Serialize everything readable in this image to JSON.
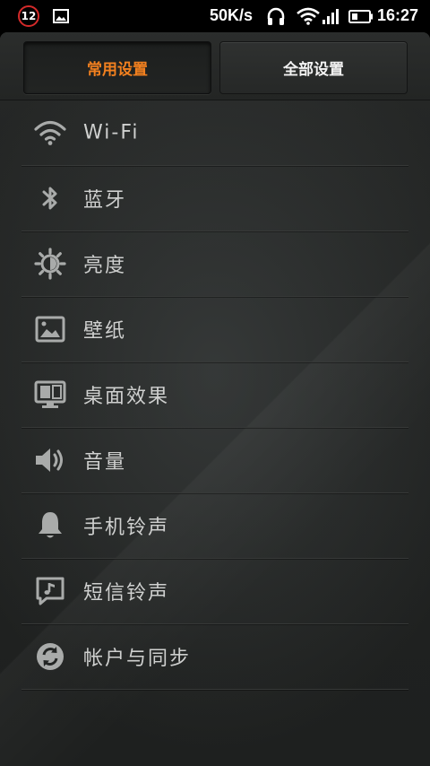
{
  "status_bar": {
    "notification_count": "12",
    "net_speed": "50K/s",
    "time": "16:27",
    "icons": [
      "image-icon",
      "headset-icon",
      "wifi-icon",
      "signal-icon",
      "battery-icon"
    ]
  },
  "tabs": [
    {
      "label": "常用设置",
      "selected": true
    },
    {
      "label": "全部设置",
      "selected": false
    }
  ],
  "settings": [
    {
      "label": "Wi-Fi",
      "icon": "wifi-icon"
    },
    {
      "label": "蓝牙",
      "icon": "bluetooth-icon"
    },
    {
      "label": "亮度",
      "icon": "brightness-icon"
    },
    {
      "label": "壁纸",
      "icon": "wallpaper-icon"
    },
    {
      "label": "桌面效果",
      "icon": "desktop-effect-icon"
    },
    {
      "label": "音量",
      "icon": "volume-icon"
    },
    {
      "label": "手机铃声",
      "icon": "ringtone-icon"
    },
    {
      "label": "短信铃声",
      "icon": "sms-tone-icon"
    },
    {
      "label": "帐户与同步",
      "icon": "sync-icon"
    }
  ],
  "colors": {
    "accent": "#f2801f",
    "text": "#cfd0cf",
    "icon": "#a9abaa",
    "badge": "#d42a2a"
  }
}
